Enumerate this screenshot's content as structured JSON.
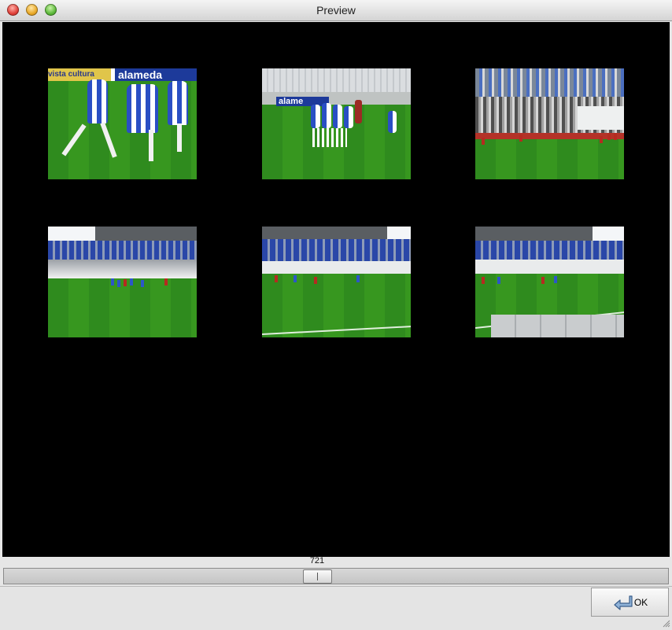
{
  "window": {
    "title": "Preview"
  },
  "thumbnails": [
    {
      "name": "frame-1",
      "banner_text": "alameda",
      "banner_prefix": "vista cultura"
    },
    {
      "name": "frame-2",
      "banner_text": "alame"
    },
    {
      "name": "frame-3"
    },
    {
      "name": "frame-4"
    },
    {
      "name": "frame-5"
    },
    {
      "name": "frame-6"
    }
  ],
  "slider": {
    "value_label": "721"
  },
  "ok_button": {
    "label": "OK",
    "icon": "arrow-return-icon"
  },
  "colors": {
    "canvas_background": "#000000",
    "pitch_green": "#2f8b1e",
    "team_blue": "#2a4fc4"
  }
}
